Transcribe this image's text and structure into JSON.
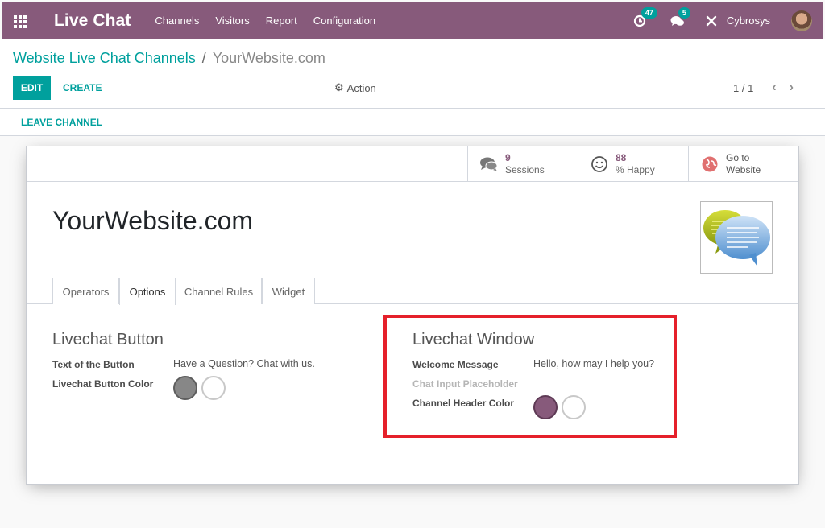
{
  "topbar": {
    "app_title": "Live Chat",
    "menu": [
      "Channels",
      "Visitors",
      "Report",
      "Configuration"
    ],
    "activity_badge": "47",
    "messages_badge": "5",
    "user_name": "Cybrosys",
    "bg_color": "#875a7b"
  },
  "breadcrumb": {
    "parent": "Website Live Chat Channels",
    "separator": "/",
    "current": "YourWebsite.com"
  },
  "toolbar": {
    "edit_label": "EDIT",
    "create_label": "CREATE",
    "action_label": "Action",
    "pager": "1 / 1"
  },
  "statusbar": {
    "leave_label": "LEAVE CHANNEL"
  },
  "stat_buttons": [
    {
      "icon": "comments-icon",
      "value": "9",
      "label": "Sessions"
    },
    {
      "icon": "smile-icon",
      "value": "88",
      "label": "% Happy"
    },
    {
      "icon": "globe-icon",
      "value": "Go to",
      "label": "Website"
    }
  ],
  "record": {
    "title": "YourWebsite.com",
    "image": "chat-bubbles-image"
  },
  "tabs": [
    {
      "label": "Operators",
      "active": false
    },
    {
      "label": "Options",
      "active": true
    },
    {
      "label": "Channel Rules",
      "active": false
    },
    {
      "label": "Widget",
      "active": false
    }
  ],
  "livechat_button": {
    "title": "Livechat Button",
    "text_label": "Text of the Button",
    "text_value": "Have a Question? Chat with us.",
    "color_label": "Livechat Button Color",
    "colors": [
      "#878787",
      "#ffffff"
    ]
  },
  "livechat_window": {
    "title": "Livechat Window",
    "welcome_label": "Welcome Message",
    "welcome_value": "Hello, how may I help you?",
    "placeholder_label": "Chat Input Placeholder",
    "placeholder_value": "",
    "header_color_label": "Channel Header Color",
    "colors": [
      "#875a7b",
      "#ffffff"
    ]
  },
  "accent_color": "#00a09d",
  "highlight_color": "#e5202a"
}
